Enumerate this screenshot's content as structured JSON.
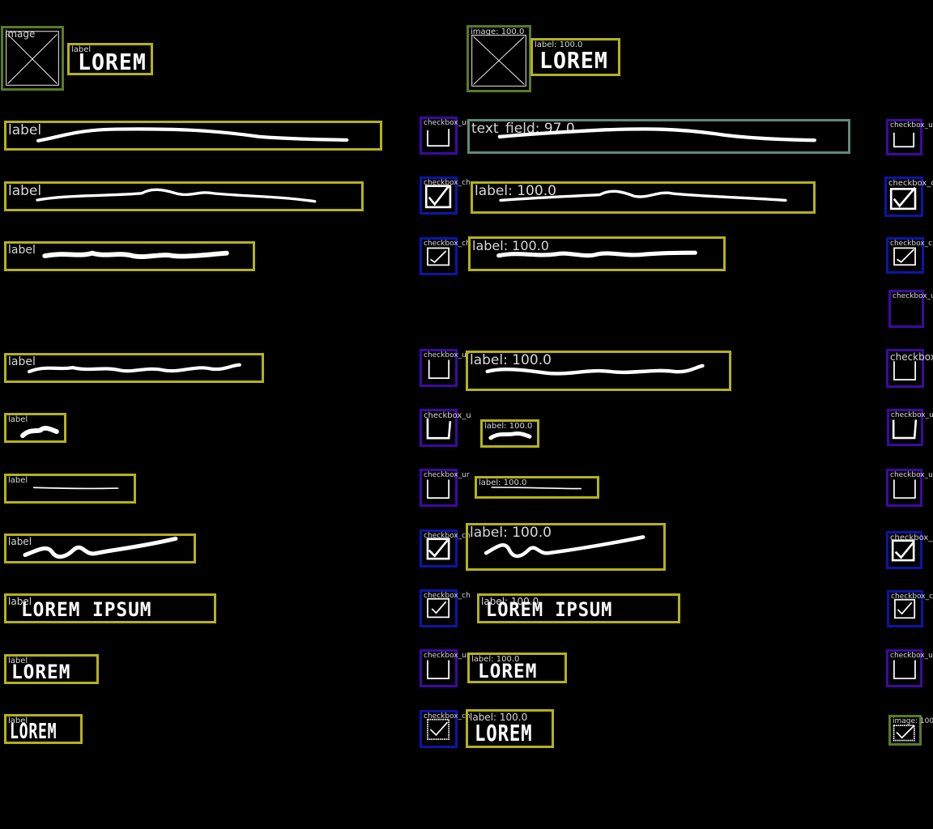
{
  "labels": {
    "image_left": "image",
    "image_right": "image: 100.0",
    "label": "label",
    "label_right": "label: 100.0",
    "text_field_right": "text_field: 97.0",
    "checkbox_checked": "checkbox_ch",
    "checkbox_checked_r": "checkbox_c",
    "checkbox_unchecked": "checkbox_ur",
    "checkbox_unchecked_r": "checkbox_ur",
    "checkbox_u": "checkbox_u",
    "checkbox_cut": "checkbox_u",
    "image_small_right": "image: 100."
  },
  "scribbles": {
    "lorem": "LOREM",
    "lorem_ipsum": "LOREM IPSUM"
  },
  "colors": {
    "background": "#000000",
    "label_box": "#b5b219",
    "image_box": "#5a7a2a",
    "text_field_box": "#5f8a7a",
    "checkbox_checked_box": "#0b16a6",
    "checkbox_unchecked_box": "#3c0aa0",
    "tag_text": "#d7d7d7",
    "stroke": "#ffffff"
  }
}
